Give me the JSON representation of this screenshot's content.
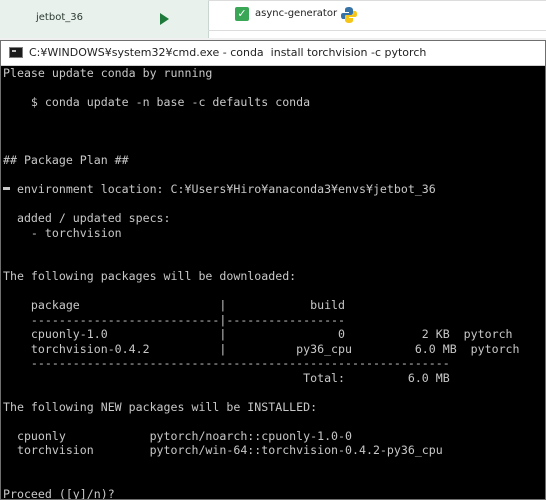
{
  "background": {
    "env_label": "jetbot_36",
    "package_label": "async-generator"
  },
  "window": {
    "title": "C:¥WINDOWS¥system32¥cmd.exe - conda  install torchvision -c pytorch"
  },
  "terminal": {
    "lines": [
      "Please update conda by running",
      "",
      "    $ conda update -n base -c defaults conda",
      "",
      "",
      "",
      "## Package Plan ##",
      "",
      "  environment location: C:¥Users¥Hiro¥anaconda3¥envs¥jetbot_36",
      "",
      "  added / updated specs:",
      "    - torchvision",
      "",
      "",
      "The following packages will be downloaded:",
      "",
      "    package                    |            build",
      "    ---------------------------|-----------------",
      "    cpuonly-1.0                |                0           2 KB  pytorch",
      "    torchvision-0.4.2          |          py36_cpu         6.0 MB  pytorch",
      "    ------------------------------------------------------------",
      "                                           Total:         6.0 MB",
      "",
      "The following NEW packages will be INSTALLED:",
      "",
      "  cpuonly            pytorch/noarch::cpuonly-1.0-0",
      "  torchvision        pytorch/win-64::torchvision-0.4.2-py36_cpu",
      "",
      "",
      "Proceed ([y]/n)?"
    ]
  },
  "colors": {
    "terminal_bg": "#000000",
    "terminal_fg": "#c8c8c8",
    "check_green": "#3aa757"
  }
}
